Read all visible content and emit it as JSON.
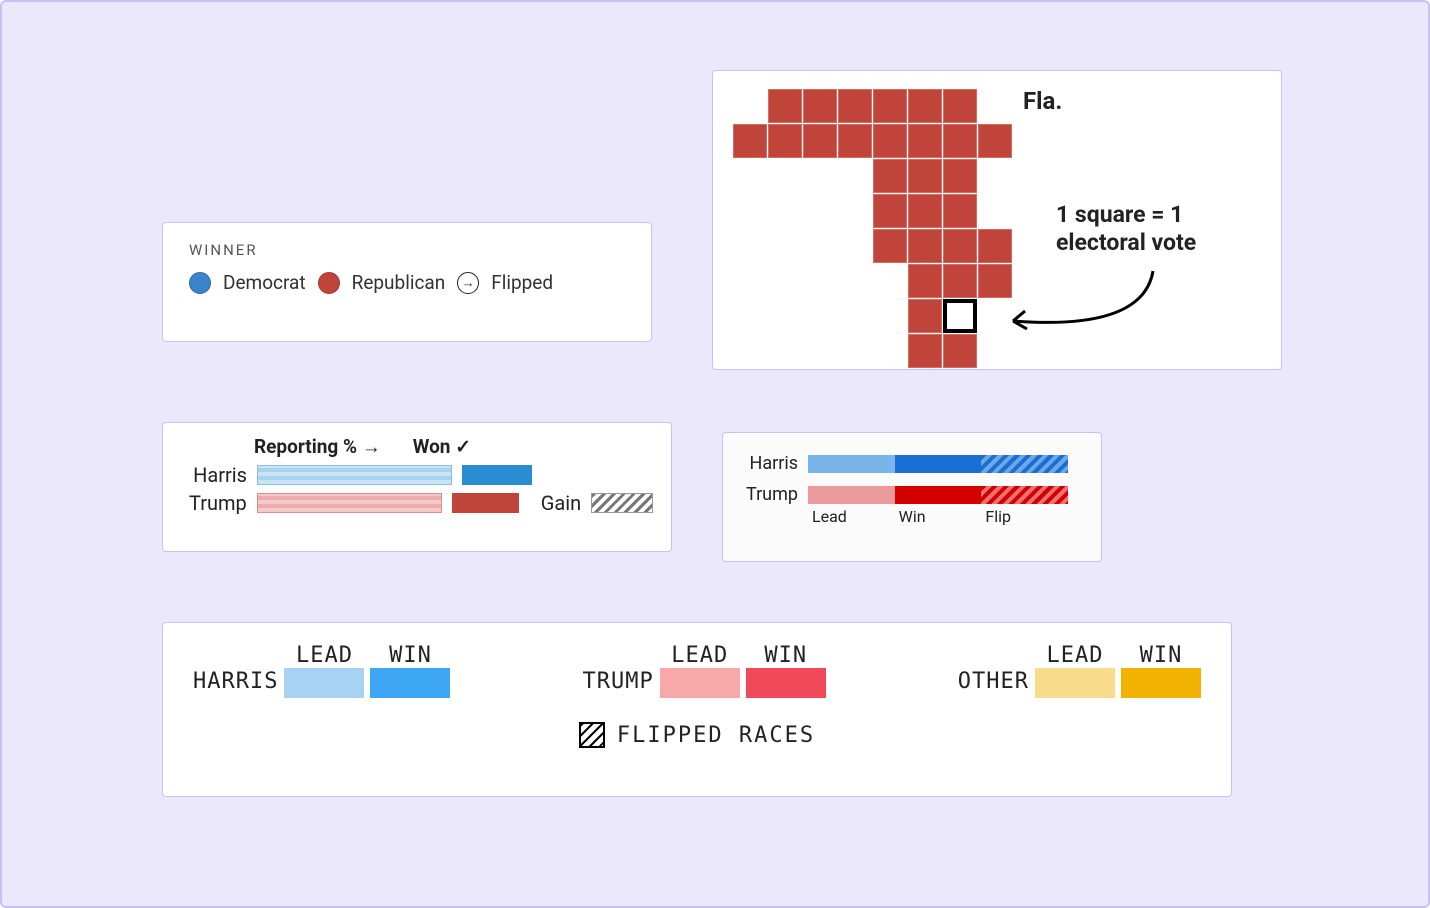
{
  "card1": {
    "heading": "WINNER",
    "dem": "Democrat",
    "rep": "Republican",
    "flipped": "Flipped"
  },
  "card2": {
    "state_label": "Fla.",
    "note": "1 square = 1 electoral vote"
  },
  "card3": {
    "reporting_hdr": "Reporting % →",
    "won_hdr": "Won ✓",
    "harris": "Harris",
    "trump": "Trump",
    "gain": "Gain"
  },
  "card4": {
    "harris": "Harris",
    "trump": "Trump",
    "lead": "Lead",
    "win": "Win",
    "flip": "Flip"
  },
  "card5": {
    "harris": "HARRIS",
    "trump": "TRUMP",
    "other": "OTHER",
    "lead": "LEAD",
    "win": "WIN",
    "flipped": "FLIPPED RACES"
  },
  "colors": {
    "democrat": "#3b84cb",
    "republican": "#c1443a"
  }
}
